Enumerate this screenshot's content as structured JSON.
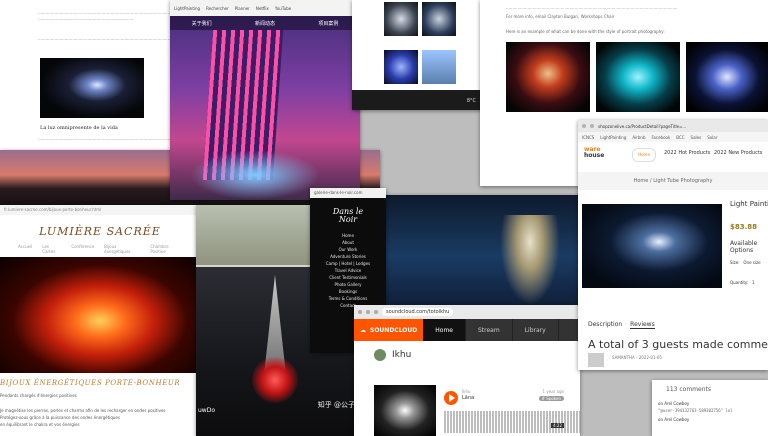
{
  "window_article": {
    "heading": "La luz omnipresente de la vida"
  },
  "window_tower": {
    "bookmarks": [
      "LightPainting",
      "Rechercher",
      "Planner",
      "Netflix",
      "YouTube"
    ],
    "nav": [
      "关于我们",
      "新闻动态",
      "项目案例"
    ]
  },
  "window_gallery": {
    "badge": "8°C"
  },
  "window_portraits": {
    "line1": "For more info, email Clayton Bulgari, Workshops Chair",
    "line2": "Here is an example of what can be done with the style of portrait photography:",
    "link": "Clayton Bulgari, Workshops Chair"
  },
  "window_lumiere": {
    "url": "fr.lumiere-sacree.com/bijoux-porte-bonheur.html",
    "title": "LUMIÈRE SACRÉE",
    "menu": [
      "Accueil",
      "Les Cartes",
      "Conférence",
      "Bijoux énergétiques",
      "Chambre Positive"
    ],
    "subtitle": "BIJOUX ÉNERGÉTIQUES PORTE-BONHEUR",
    "line1": "Pendants chargés d'énergies positives",
    "line2": "Je magnétise les pierres, perles et charms afin de les recharger en ondes positives",
    "line3": "Protégez-vous grâce à la puissance des ondes énergétiques",
    "line4": "en équilibrant le chakra et vos énergies"
  },
  "window_sculpture": {
    "watermark": "知乎 @公子",
    "corner": "uwDo"
  },
  "window_dark_site": {
    "url": "galerie-dans-le-noir.com",
    "logo": "Dans le Noir",
    "menu": [
      "Home",
      "About",
      "Our Work",
      "Adventure Stories",
      "Camp | Hotel | Lodges",
      "Travel Advice",
      "Client Testimonials",
      "Photo Gallery",
      "Bookings",
      "Terms & Conditions",
      "Contact"
    ]
  },
  "window_soundcloud": {
    "url": "soundcloud.com/totoikhu",
    "brand": "SOUNDCLOUD",
    "tabs": [
      "Home",
      "Stream",
      "Library"
    ],
    "user": "Ikhu",
    "artist": "Ikhu",
    "track": "Lāna",
    "posted": "1 year ago",
    "tag": "# Spoken",
    "duration": "4:22"
  },
  "window_shop": {
    "url": "shopzonelive.ca/ProductDetail?pageTitle=...",
    "bookmarks": [
      "ICNCS",
      "LightPainting",
      "Airbnb",
      "Facebook",
      "BCC",
      "Sales",
      "Solar"
    ],
    "logo_top": "ware",
    "logo_bottom": "house",
    "pill": "Home",
    "nav": [
      "2022 Hot Products",
      "2022 New Products"
    ],
    "breadcrumb": "Home / Light Tube Photography",
    "product": "Light Painting",
    "price": "$83.88",
    "availability": "Available Options",
    "size_label": "Size:",
    "size_value": "One size",
    "qty_label": "Quantity:",
    "qty_value": "1",
    "tab_description": "Description",
    "tab_reviews": "Reviews",
    "review_heading": "A total of 3 guests made comments",
    "review_by": "SAMANTHA - 2022-01-05"
  },
  "window_comments": {
    "count": "113 comments",
    "c1": "on Arel Cowboy",
    "code": "\"@user-394132763-589302756\" lol",
    "c2": "on Arel Cowboy"
  }
}
